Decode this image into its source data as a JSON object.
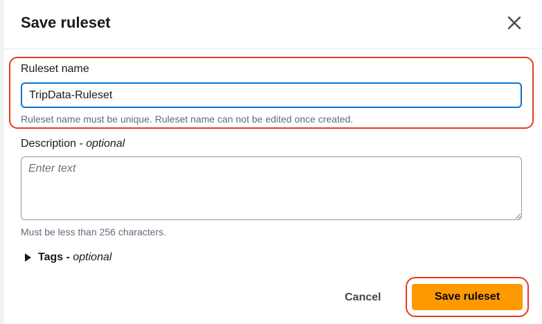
{
  "modal": {
    "title": "Save ruleset",
    "close_icon": "close-icon"
  },
  "ruleset_name": {
    "label": "Ruleset name",
    "value": "TripData-Ruleset",
    "hint": "Ruleset name must be unique. Ruleset name can not be edited once created."
  },
  "description": {
    "label": "Description",
    "label_separator": " - ",
    "optional": "optional",
    "placeholder": "Enter text",
    "hint": "Must be less than 256 characters."
  },
  "tags": {
    "label": "Tags",
    "label_separator": " - ",
    "optional": "optional",
    "icon": "caret-right-icon"
  },
  "footer": {
    "cancel_label": "Cancel",
    "save_label": "Save ruleset"
  },
  "colors": {
    "highlight": "#e5391f",
    "primary_button": "#ff9900",
    "input_focus": "#0972d3"
  }
}
